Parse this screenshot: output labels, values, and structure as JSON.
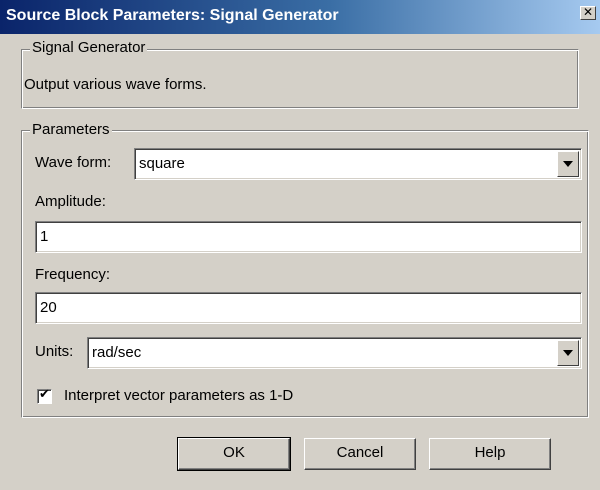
{
  "window": {
    "title": "Source Block Parameters: Signal Generator",
    "close_glyph": "✕"
  },
  "description_group": {
    "legend": "Signal Generator",
    "text": "Output various wave forms."
  },
  "parameters_group": {
    "legend": "Parameters",
    "wave_form": {
      "label": "Wave form:",
      "value": "square"
    },
    "amplitude": {
      "label": "Amplitude:",
      "value": "1"
    },
    "frequency": {
      "label": "Frequency:",
      "value": "20"
    },
    "units": {
      "label": "Units:",
      "value": "rad/sec"
    },
    "interpret_vector": {
      "label": "Interpret vector parameters as 1-D",
      "checked": true,
      "check_glyph": "✔"
    }
  },
  "buttons": {
    "ok": "OK",
    "cancel": "Cancel",
    "help": "Help"
  },
  "icons": {
    "close": "close-icon",
    "dropdown": "chevron-down-icon",
    "check": "checkmark-icon"
  }
}
